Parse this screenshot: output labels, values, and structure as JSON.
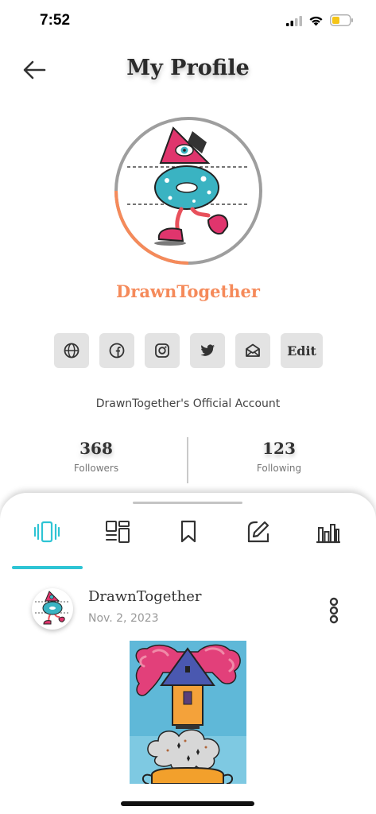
{
  "status_bar": {
    "time": "7:52",
    "battery_color": "#f5c518"
  },
  "header": {
    "title": "My Profile",
    "back_icon": "arrow-left-icon"
  },
  "profile": {
    "username": "DrawnTogether",
    "bio": "DrawnTogether's Official Account",
    "ring_colors": {
      "accent": "#f58a5a",
      "base": "#9e9e9e"
    }
  },
  "social_buttons": [
    {
      "icon": "globe-icon"
    },
    {
      "icon": "facebook-icon"
    },
    {
      "icon": "instagram-icon"
    },
    {
      "icon": "twitter-icon"
    },
    {
      "icon": "mail-icon"
    }
  ],
  "edit_label": "Edit",
  "stats": {
    "followers": {
      "count": "368",
      "label": "Followers"
    },
    "following": {
      "count": "123",
      "label": "Following"
    }
  },
  "tabs": [
    {
      "icon": "carousel-icon",
      "active": true
    },
    {
      "icon": "layout-grid-icon",
      "active": false
    },
    {
      "icon": "bookmark-icon",
      "active": false
    },
    {
      "icon": "edit-icon",
      "active": false
    },
    {
      "icon": "bar-chart-icon",
      "active": false
    }
  ],
  "accent_color": "#2ec4d4",
  "post": {
    "author": "DrawnTogether",
    "date": "Nov. 2, 2023",
    "more_icon": "more-vertical-icon"
  }
}
